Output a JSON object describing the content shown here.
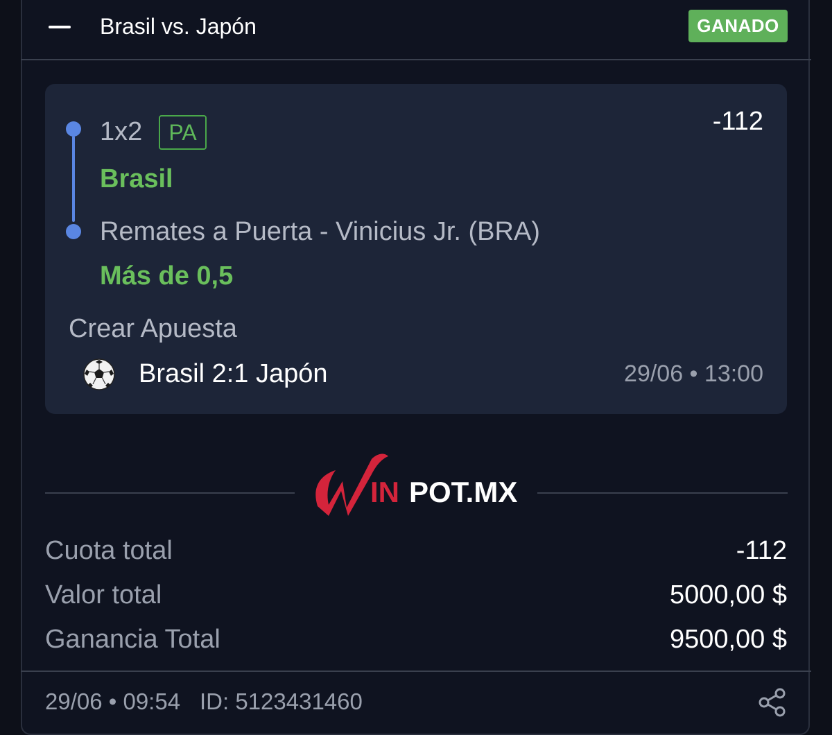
{
  "header": {
    "title": "Brasil vs. Japón",
    "status": "GANADO"
  },
  "selections": [
    {
      "market": "1x2",
      "tag": "PA",
      "pick": "Brasil"
    },
    {
      "market": "Remates a Puerta - Vinicius Jr. (BRA)",
      "pick": "Más de 0,5"
    }
  ],
  "combined_odds": "-112",
  "bet_type": "Crear Apuesta",
  "event": {
    "score": "Brasil 2:1 Japón",
    "datetime": "29/06 • 13:00"
  },
  "logo": {
    "part1": "W",
    "part2": "IN",
    "part3": "POT.MX"
  },
  "summary": [
    {
      "label": "Cuota total",
      "value": "-112"
    },
    {
      "label": "Valor total",
      "value": "5000,00 $"
    },
    {
      "label": "Ganancia Total",
      "value": "9500,00 $"
    }
  ],
  "footer": {
    "datetime": "29/06 • 09:54",
    "id": "ID: 5123431460"
  },
  "colors": {
    "background": "#0d1019",
    "card": "#1d2538",
    "win_green": "#5fb05a",
    "timeline_blue": "#5a86e2",
    "brand_red": "#d4243b"
  },
  "icons": [
    "collapse-icon",
    "soccer-ball-icon",
    "share-icon"
  ]
}
